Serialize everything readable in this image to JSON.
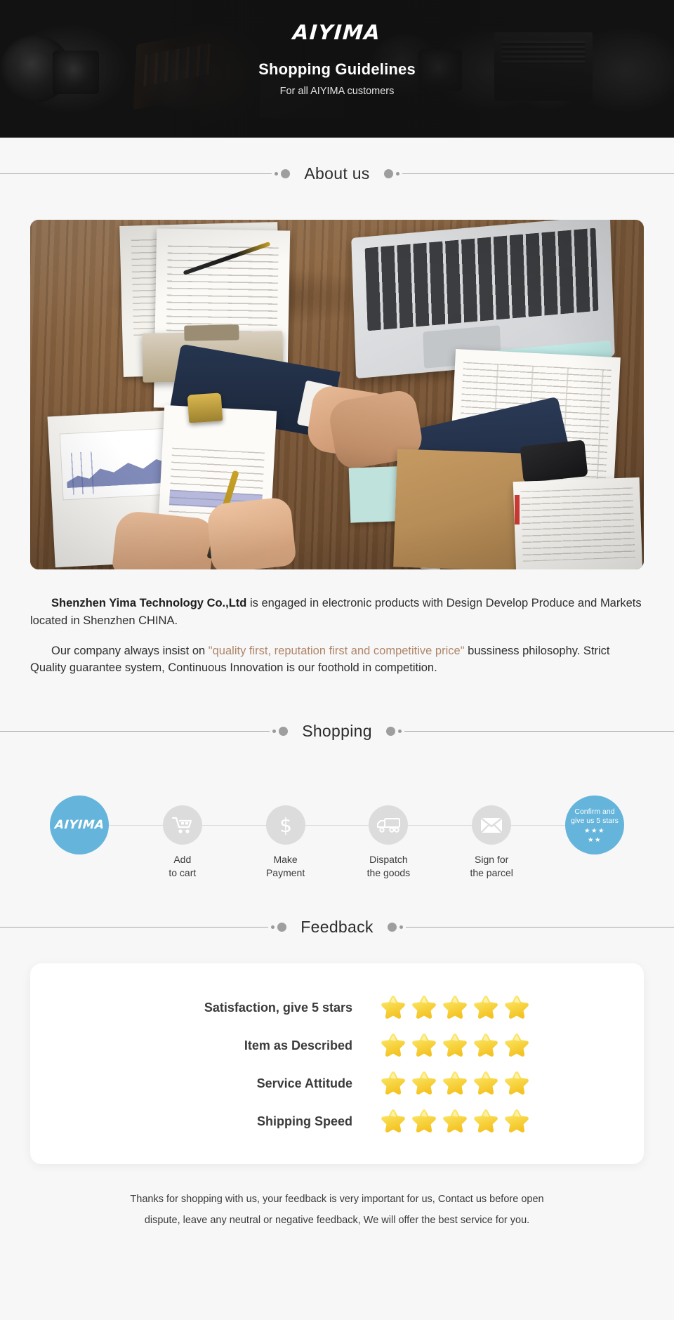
{
  "hero": {
    "brand": "AIYIMA",
    "title": "Shopping Guidelines",
    "subtitle": "For all AIYIMA customers"
  },
  "sections": {
    "about_title": "About us",
    "shopping_title": "Shopping",
    "feedback_title": "Feedback"
  },
  "about": {
    "photo_alt": "business-handshake-desk-photo",
    "p1_strong": "Shenzhen Yima Technology Co.,Ltd",
    "p1_rest": " is engaged in electronic products with Design Develop Produce and Markets located in Shenzhen CHINA.",
    "p2_pre": "Our company always insist on ",
    "p2_quote": "\"quality first, reputation first and competitive price\"",
    "p2_post": " bussiness philosophy. Strict Quality guarantee system, Continuous Innovation is our foothold in competition.",
    "quote_color": "#b0866a"
  },
  "shopping": {
    "accent_color": "#65b4db",
    "circle_color": "#dcdcdc",
    "steps": [
      {
        "id": "brand",
        "icon": "aiyima-logo-icon",
        "brand_text": "AIYIMA",
        "label": ""
      },
      {
        "id": "cart",
        "icon": "shopping-cart-icon",
        "label": "Add\nto cart"
      },
      {
        "id": "payment",
        "icon": "dollar-sign-icon",
        "label": "Make\nPayment"
      },
      {
        "id": "dispatch",
        "icon": "delivery-truck-icon",
        "label": "Dispatch\nthe goods"
      },
      {
        "id": "sign",
        "icon": "envelope-icon",
        "label": "Sign for\nthe parcel"
      },
      {
        "id": "confirm",
        "icon": "five-stars-icon",
        "final_text": "Confirm and\ngive us 5 stars",
        "stars_row1": "★★★",
        "stars_row2": "★★",
        "label": ""
      }
    ]
  },
  "feedback": {
    "star_color": "#f7cf3d",
    "rows": [
      {
        "label": "Satisfaction, give 5 stars",
        "stars": 5
      },
      {
        "label": "Item as Described",
        "stars": 5
      },
      {
        "label": "Service Attitude",
        "stars": 5
      },
      {
        "label": "Shipping Speed",
        "stars": 5
      }
    ]
  },
  "footer": {
    "line1": "Thanks for shopping with us, your feedback is very important for us, Contact us before open",
    "line2": "dispute, leave any neutral or negative feedback, We will offer the best service for you."
  }
}
